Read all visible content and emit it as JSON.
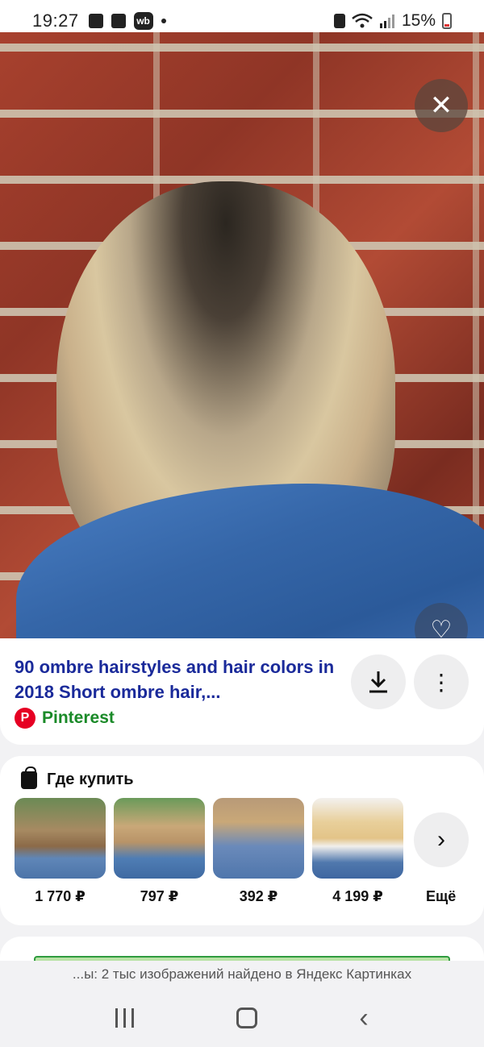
{
  "status_bar": {
    "time": "19:27",
    "battery": "15%"
  },
  "viewer": {
    "close_label": "✕",
    "like_label": "♡"
  },
  "result": {
    "title": "90 ombre hairstyles and hair colors in 2018 Short ombre hair,...",
    "source": "Pinterest",
    "download_label": "⤓",
    "more_label": "⋮"
  },
  "shop": {
    "title": "Где купить",
    "products": [
      {
        "price": "1 770 ₽"
      },
      {
        "price": "797 ₽"
      },
      {
        "price": "392 ₽"
      },
      {
        "price": "4 199 ₽"
      }
    ],
    "more_arrow": "›",
    "more_label": "Ещё"
  },
  "banner": {
    "text": "...ы: 2 тыс изображений найдено в Яндекс Картинках"
  },
  "nav": {
    "back": "‹"
  }
}
